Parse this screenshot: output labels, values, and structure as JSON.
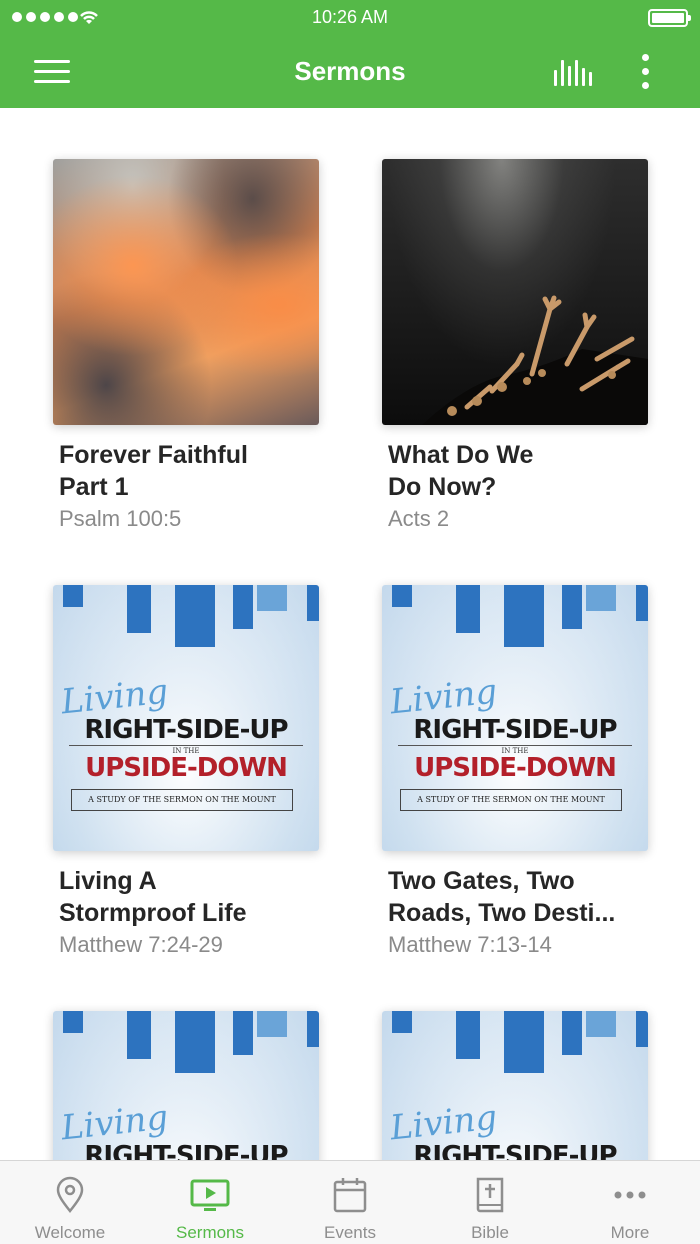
{
  "status_bar": {
    "time": "10:26 AM"
  },
  "header": {
    "title": "Sermons"
  },
  "sermons": [
    {
      "title_line1": "Forever Faithful",
      "title_line2": "Part 1",
      "scripture": "Psalm 100:5",
      "artwork": "clouds"
    },
    {
      "title_line1": "What Do We",
      "title_line2": "Do Now?",
      "scripture": "Acts 2",
      "artwork": "raised-hands"
    },
    {
      "title_line1": "Living A",
      "title_line2": "Stormproof Life",
      "scripture": "Matthew 7:24-29",
      "artwork": "living-right-side-up"
    },
    {
      "title_line1": "Two Gates, Two",
      "title_line2": "Roads, Two Desti...",
      "scripture": "Matthew 7:13-14",
      "artwork": "living-right-side-up"
    },
    {
      "artwork": "living-right-side-up"
    },
    {
      "artwork": "living-right-side-up"
    }
  ],
  "series_artwork": {
    "script": "Living",
    "line1": "RIGHT-SIDE-UP",
    "line2": "IN THE",
    "line3": "UPSIDE-DOWN",
    "subtitle": "A STUDY OF THE SERMON ON THE MOUNT"
  },
  "tabs": [
    {
      "label": "Welcome",
      "icon": "map-pin-icon",
      "active": false
    },
    {
      "label": "Sermons",
      "icon": "tv-play-icon",
      "active": true
    },
    {
      "label": "Events",
      "icon": "calendar-icon",
      "active": false
    },
    {
      "label": "Bible",
      "icon": "bible-icon",
      "active": false
    },
    {
      "label": "More",
      "icon": "more-dots-icon",
      "active": false
    }
  ],
  "colors": {
    "brand": "#55b948",
    "inactive_tab": "#8e8e8e"
  }
}
